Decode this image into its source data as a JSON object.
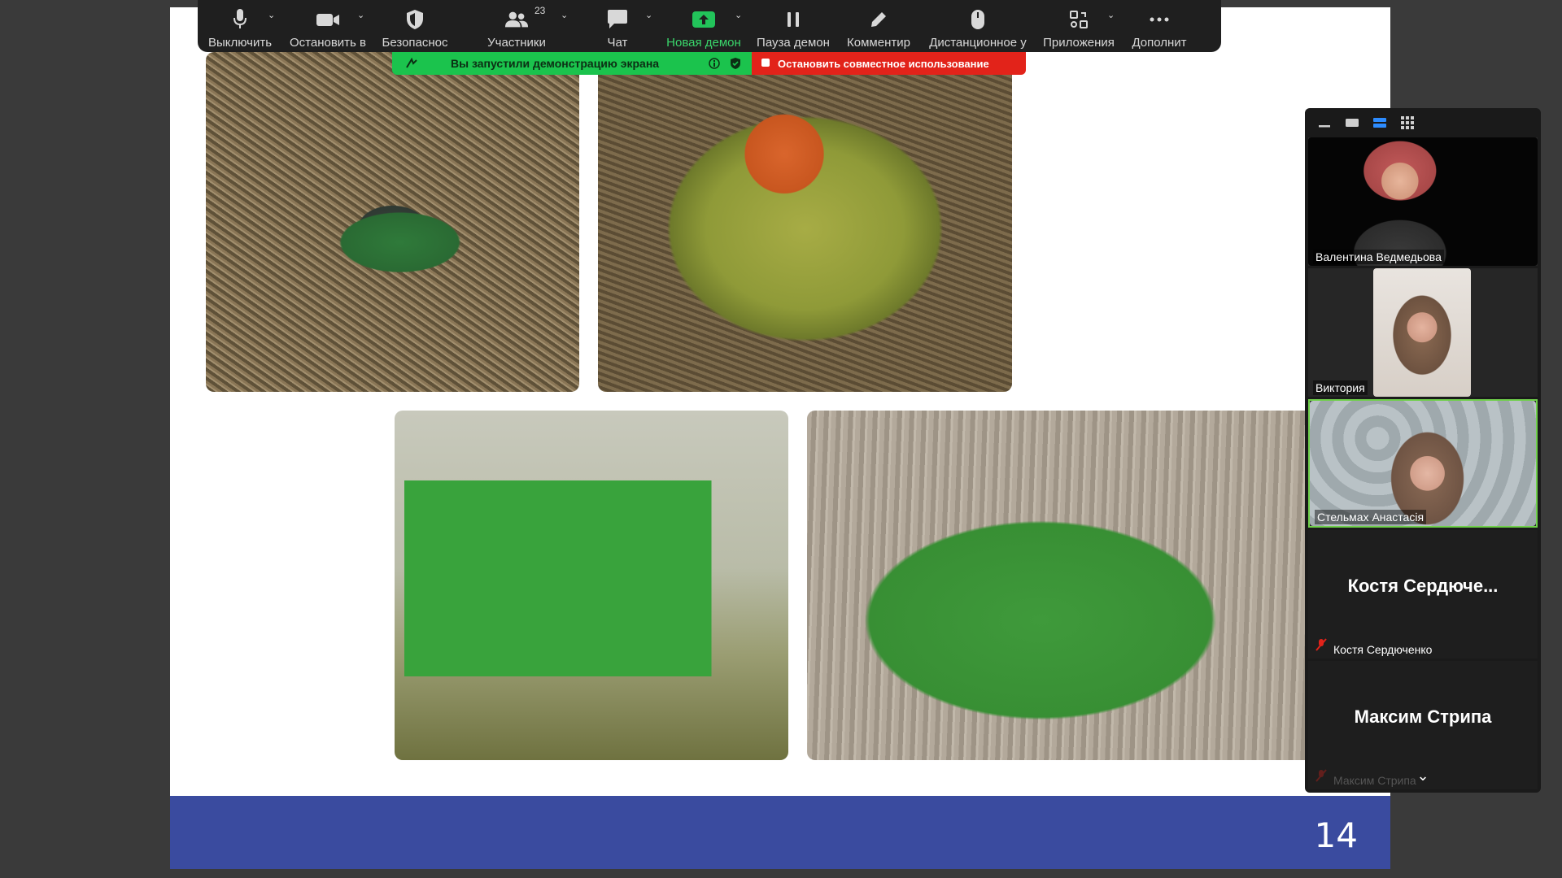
{
  "toolbar": {
    "items": [
      {
        "label": "Выключить",
        "icon": "microphone-icon"
      },
      {
        "label": "Остановить в",
        "icon": "video-camera-icon"
      },
      {
        "label": "Безопаснос",
        "icon": "shield-icon"
      },
      {
        "label": "Участники",
        "icon": "participants-icon",
        "count": "23"
      },
      {
        "label": "Чат",
        "icon": "chat-icon"
      },
      {
        "label": "Новая демон",
        "icon": "share-screen-icon"
      },
      {
        "label": "Пауза демон",
        "icon": "pause-icon"
      },
      {
        "label": "Комментир",
        "icon": "pencil-icon"
      },
      {
        "label": "Дистанционное у",
        "icon": "mouse-icon"
      },
      {
        "label": "Приложения",
        "icon": "apps-icon"
      },
      {
        "label": "Дополнит",
        "icon": "more-icon"
      }
    ]
  },
  "share_banner": {
    "text": "Вы запустили демонстрацию экрана"
  },
  "stop_share": {
    "text": "Остановить совместное использование"
  },
  "slide": {
    "page_number": "14"
  },
  "gallery": {
    "participants": [
      {
        "name": "Валентина Ведмедьова"
      },
      {
        "name": "Виктория"
      },
      {
        "name": "Стельмах Анастасія"
      },
      {
        "name": "Костя Сердюченко",
        "display": "Костя  Сердюче..."
      },
      {
        "name": "Максим Стрипа",
        "display": "Максим Стрипа"
      }
    ]
  },
  "colors": {
    "toolbar_bg": "#1f1f1f",
    "share_green": "#1bc34d",
    "stop_red": "#e2231a",
    "slide_footer": "#3a4b9f",
    "active_speaker": "#6fd04a"
  }
}
